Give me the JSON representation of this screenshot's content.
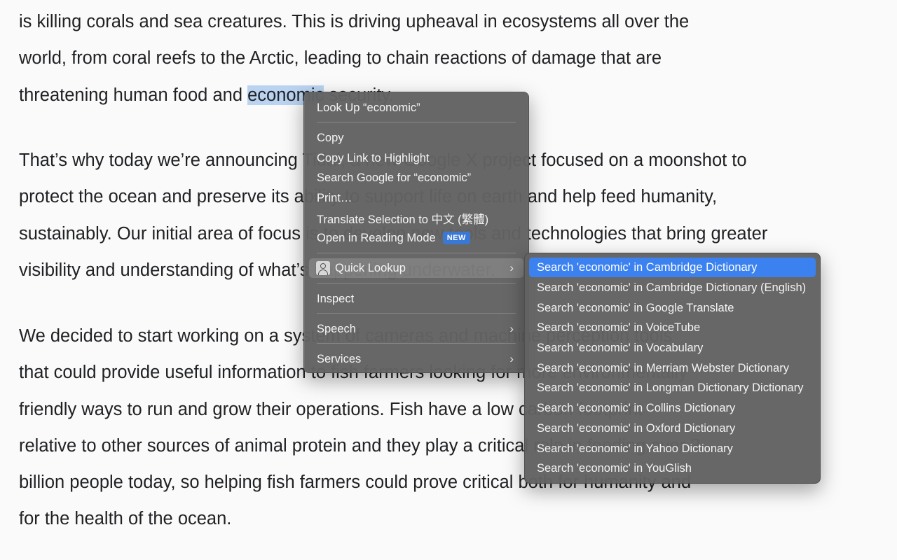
{
  "article": {
    "para1": [
      "is killing corals and sea creatures. This is driving upheaval in ecosystems all over the",
      "world, from coral reefs to the Arctic, leading to chain reactions of damage that are"
    ],
    "para1_line3_before": "threatening human food and ",
    "para1_line3_highlight": "economic",
    "para1_line3_after": " security.",
    "para2": [
      "That’s why today we’re announcing Tidal, a new Google X project focused on a moonshot to",
      "protect the ocean and preserve its ability to support life on earth and help feed humanity,",
      "sustainably. Our initial area of focus is to develop new tools and technologies that bring greater",
      "visibility and understanding of what’s happening underwater."
    ],
    "para3": [
      "We decided to start working on a system of cameras and machine perception tools",
      "that could provide useful information to fish farmers looking for more environmentally",
      "friendly ways to run and grow their operations. Fish have a low carbon footprint",
      "relative to other sources of animal protein and they play a critical role in feeding over 3",
      "billion people today, so helping fish farmers could prove critical both for humanity and",
      "for the health of the ocean."
    ]
  },
  "menu": {
    "look_up": "Look Up “economic”",
    "copy": "Copy",
    "copy_link": "Copy Link to Highlight",
    "search_google": "Search Google for “economic”",
    "print": "Print…",
    "translate": "Translate Selection to 中文 (繁體)",
    "reading_mode": "Open in Reading Mode",
    "new_badge": "NEW",
    "quick_lookup": "Quick Lookup",
    "inspect": "Inspect",
    "speech": "Speech",
    "services": "Services",
    "chevron": "›"
  },
  "submenu": {
    "items": [
      "Search 'economic' in Cambridge Dictionary",
      "Search 'economic' in Cambridge Dictionary (English)",
      "Search 'economic' in Google Translate",
      "Search 'economic' in VoiceTube",
      "Search 'economic' in Vocabulary",
      "Search 'economic' in Merriam Webster Dictionary",
      "Search 'economic' in Longman Dictionary Dictionary",
      "Search 'economic' in Collins Dictionary",
      "Search 'economic' in Oxford Dictionary",
      "Search 'economic' in Yahoo Dictionary",
      "Search 'economic' in YouGlish"
    ]
  },
  "colors": {
    "highlight": "#b9d3f1",
    "menu_bg": "#626262",
    "submenu_selected": "#3b82f0",
    "badge": "#3a78d6"
  }
}
